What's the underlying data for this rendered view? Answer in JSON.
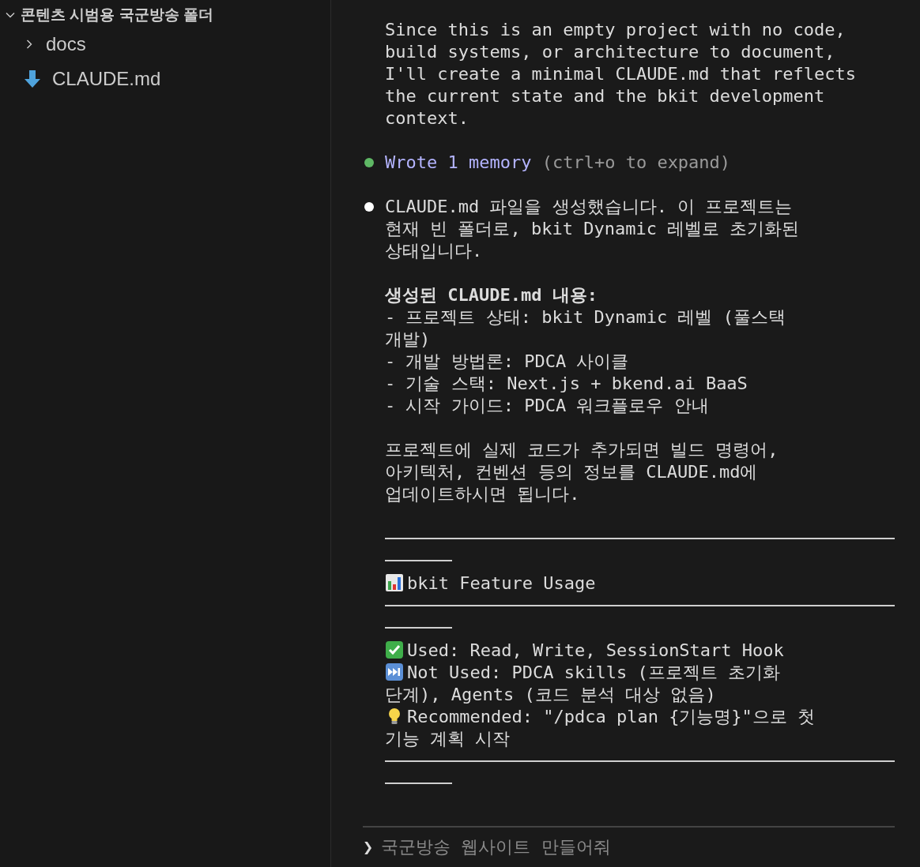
{
  "explorer": {
    "root": {
      "label": "콘텐츠 시범용 국군방송 폴더",
      "expanded": true,
      "children": [
        {
          "kind": "folder",
          "label": "docs",
          "expanded": false
        },
        {
          "kind": "file",
          "label": "CLAUDE.md"
        }
      ]
    }
  },
  "transcript": [
    {
      "kind": "text",
      "lines": [
        "Since this is an empty project with no code,",
        "build systems, or architecture to document,",
        "I'll create a minimal CLAUDE.md that reflects",
        "the current state and the bkit development",
        "context."
      ]
    },
    {
      "kind": "tool",
      "title": "Wrote 1 memory",
      "hint": "(ctrl+o to expand)"
    },
    {
      "kind": "message",
      "lines": [
        "CLAUDE.md 파일을 생성했습니다. 이 프로젝트는",
        "현재 빈 폴더로, bkit Dynamic 레벨로 초기화된",
        "상태입니다."
      ]
    },
    {
      "kind": "text",
      "lines": [
        "**생성된 CLAUDE.md 내용:**",
        "- 프로젝트 상태: bkit Dynamic 레벨 (풀스택",
        "개발)",
        "- 개발 방법론: PDCA 사이클",
        "- 기술 스택: Next.js + bkend.ai BaaS",
        "- 시작 가이드: PDCA 워크플로우 안내"
      ]
    },
    {
      "kind": "text",
      "lines": [
        "프로젝트에 실제 코드가 추가되면 빌드 명령어,",
        "아키텍처, 컨벤션 등의 정보를 CLAUDE.md에",
        "업데이트하시면 됩니다."
      ]
    },
    {
      "kind": "rule"
    },
    {
      "kind": "chart-heading",
      "lines": [
        "bkit Feature Usage"
      ]
    },
    {
      "kind": "rule"
    },
    {
      "kind": "used",
      "lines": [
        "Used: Read, Write, SessionStart Hook"
      ]
    },
    {
      "kind": "skipped",
      "lines": [
        "Not Used: PDCA skills (프로젝트 초기화",
        "단계), Agents (코드 분석 대상 없음)"
      ]
    },
    {
      "kind": "recommended",
      "lines": [
        "Recommended: \"/pdca plan {기능명}\"으로 첫",
        "기능 계획 시작"
      ]
    },
    {
      "kind": "rule"
    }
  ],
  "prompt": {
    "symbol": "❯",
    "placeholder": "국군방송 웹사이트 만들어줘"
  }
}
